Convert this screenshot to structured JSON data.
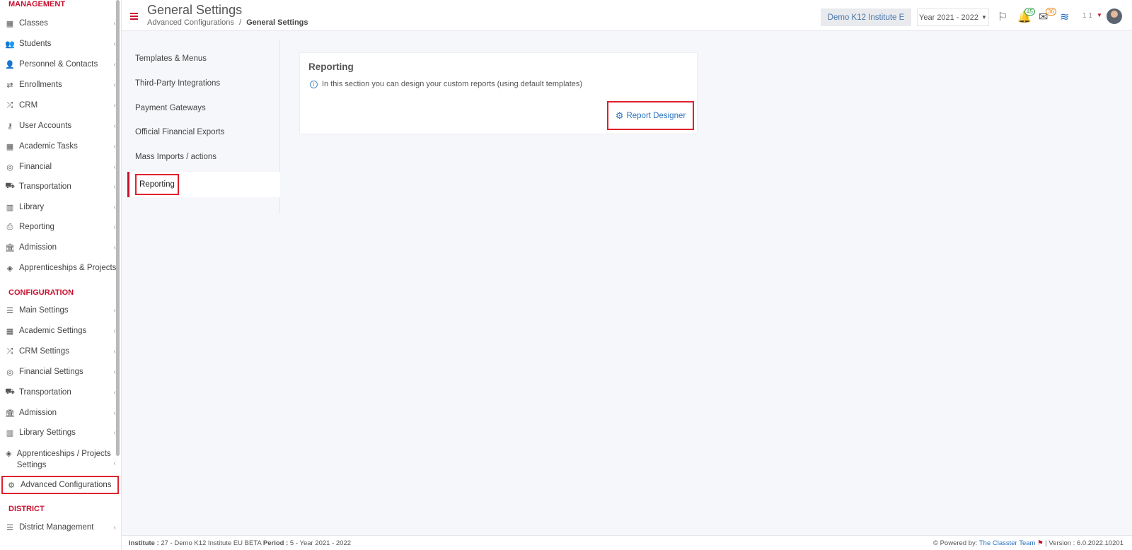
{
  "sidebar": {
    "management_label": "MANAGEMENT",
    "management_items": [
      {
        "label": "Classes",
        "icon": "classes-icon"
      },
      {
        "label": "Students",
        "icon": "students-icon"
      },
      {
        "label": "Personnel & Contacts",
        "icon": "personnel-icon"
      },
      {
        "label": "Enrollments",
        "icon": "enrollments-icon"
      },
      {
        "label": "CRM",
        "icon": "crm-icon"
      },
      {
        "label": "User Accounts",
        "icon": "key-icon"
      },
      {
        "label": "Academic Tasks",
        "icon": "tasks-icon"
      },
      {
        "label": "Financial",
        "icon": "coins-icon"
      },
      {
        "label": "Transportation",
        "icon": "bus-icon"
      },
      {
        "label": "Library",
        "icon": "library-icon"
      },
      {
        "label": "Reporting",
        "icon": "printer-icon"
      },
      {
        "label": "Admission",
        "icon": "institution-icon"
      },
      {
        "label": "Apprenticeships & Projects",
        "icon": "cube-icon"
      }
    ],
    "configuration_label": "CONFIGURATION",
    "configuration_items": [
      {
        "label": "Main Settings",
        "icon": "sliders-icon"
      },
      {
        "label": "Academic Settings",
        "icon": "classes-icon"
      },
      {
        "label": "CRM Settings",
        "icon": "crm-icon"
      },
      {
        "label": "Financial Settings",
        "icon": "coins-icon"
      },
      {
        "label": "Transportation",
        "icon": "bus-icon"
      },
      {
        "label": "Admission",
        "icon": "institution-icon"
      },
      {
        "label": "Library Settings",
        "icon": "library-icon"
      },
      {
        "label": "Apprenticeships / Projects Settings",
        "icon": "cube-icon"
      },
      {
        "label": "Advanced Configurations",
        "icon": "gears-icon"
      }
    ],
    "district_label": "DISTRICT",
    "district_items": [
      {
        "label": "District Management",
        "icon": "menu-icon"
      }
    ]
  },
  "header": {
    "title": "General Settings",
    "breadcrumb_parent": "Advanced Configurations",
    "breadcrumb_sep": "/",
    "breadcrumb_current": "General Settings",
    "institute": "Demo K12 Institute E",
    "year": "Year 2021 - 2022",
    "notif_count": "45",
    "mail_count": "36",
    "user_num": "1 1"
  },
  "settings_menu": [
    "Templates & Menus",
    "Third-Party Integrations",
    "Payment Gateways",
    "Official Financial Exports",
    "Mass Imports / actions",
    "Reporting"
  ],
  "card": {
    "title": "Reporting",
    "info": "In this section you can design your custom reports (using default templates)",
    "button": "Report Designer"
  },
  "footer": {
    "institute_label": "Institute :",
    "institute_value": "27 - Demo K12 Institute EU BETA",
    "period_label": "Period :",
    "period_value": "5 - Year 2021 - 2022",
    "powered": "Powered by:",
    "team": "The Classter Team",
    "version": "| Version : 6.0.2022.10201"
  },
  "colors": {
    "accent": "#c8102e",
    "link": "#2a73c0",
    "highlight_box": "#e0212d"
  }
}
